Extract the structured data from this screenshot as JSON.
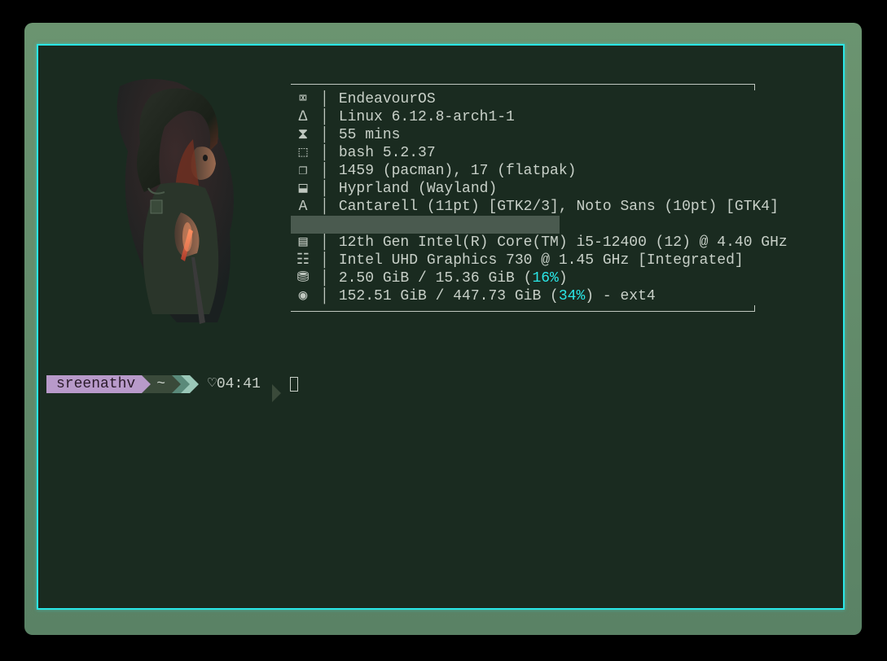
{
  "fetch": {
    "rows": [
      {
        "icon": "laptop-icon",
        "glyph": "💻",
        "value": "EndeavourOS"
      },
      {
        "icon": "linux-icon",
        "glyph": "🐧",
        "value": "Linux 6.12.8-arch1-1"
      },
      {
        "icon": "hourglass-icon",
        "glyph": "⏳",
        "value": "55 mins"
      },
      {
        "icon": "shell-icon",
        "glyph": "❯",
        "value": "bash 5.2.37"
      },
      {
        "icon": "package-icon",
        "glyph": "📦",
        "value": "1459 (pacman), 17 (flatpak)"
      },
      {
        "icon": "wm-icon",
        "glyph": "🪟",
        "value": "Hyprland (Wayland)"
      },
      {
        "icon": "font-icon",
        "glyph": "A",
        "value": "Cantarell (11pt) [GTK2/3], Noto Sans (10pt) [GTK4]"
      },
      {
        "icon": "redacted-icon",
        "glyph": "",
        "value": "",
        "redacted": true
      },
      {
        "icon": "cpu-icon",
        "glyph": "▤",
        "value": "12th Gen Intel(R) Core(TM) i5-12400 (12) @ 4.40 GHz"
      },
      {
        "icon": "gpu-icon",
        "glyph": "▥",
        "value": "Intel UHD Graphics 730 @ 1.45 GHz [Integrated]"
      },
      {
        "icon": "memory-icon",
        "glyph": "⛃",
        "value_pre": "2.50 GiB / 15.36 GiB (",
        "pct": "16%",
        "value_post": ")"
      },
      {
        "icon": "disk-icon",
        "glyph": "◉",
        "value_pre": "152.51 GiB / 447.73 GiB (",
        "pct": "34%",
        "value_post": ") - ext4"
      }
    ]
  },
  "prompt": {
    "user": "sreenathv",
    "dir": "~",
    "heart": "♡",
    "time": "04:41"
  }
}
